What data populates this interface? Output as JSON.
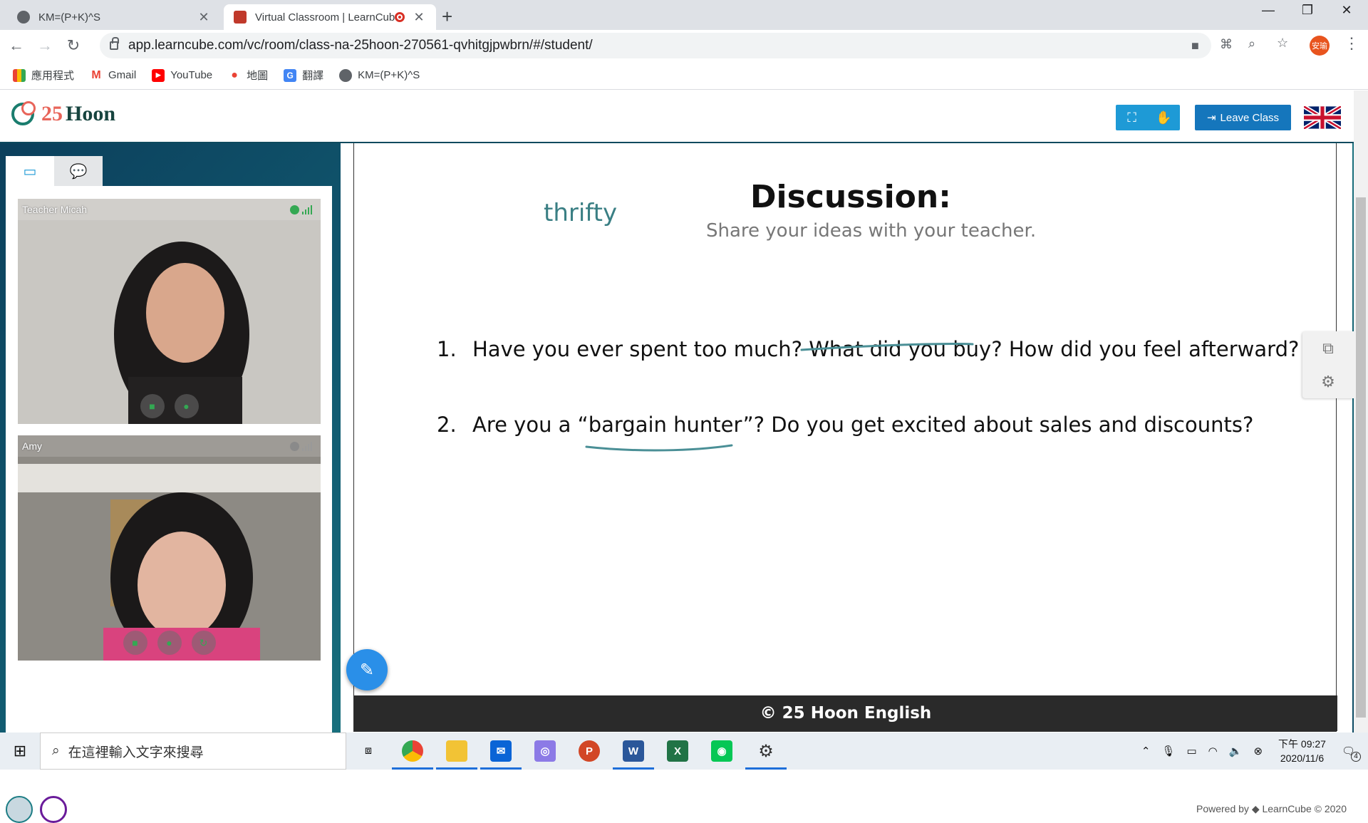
{
  "browser": {
    "tabs": [
      {
        "title": "KM=(P+K)^S",
        "active": false
      },
      {
        "title": "Virtual Classroom | LearnCube",
        "active": true
      }
    ],
    "url": "app.learncube.com/vc/room/class-na-25hoon-270561-qvhitgjpwbrn/#/student/",
    "profile_label": "安瑜",
    "bookmarks": [
      "應用程式",
      "Gmail",
      "YouTube",
      "地圖",
      "翻譯",
      "KM=(P+K)^S"
    ]
  },
  "app": {
    "logo": {
      "number": "25",
      "word": "Hoon"
    },
    "leave_label": "Leave Class",
    "participants": [
      {
        "name": "Teacher Micah",
        "status_color": "#34a853"
      },
      {
        "name": "Amy",
        "status_color": "#8a8a8a"
      }
    ],
    "powered_by": "Powered by ◆ LearnCube © 2020"
  },
  "slide": {
    "word": "thrifty",
    "title": "Discussion:",
    "subtitle": "Share your ideas with your teacher.",
    "questions": [
      {
        "num": "1.",
        "text": "Have you ever spent too much? What did you buy? How did you feel afterward?"
      },
      {
        "num": "2.",
        "text": "Are you a “bargain hunter”? Do you get excited about sales and discounts?"
      }
    ],
    "footer": "© 25 Hoon English"
  },
  "taskbar": {
    "search_placeholder": "在這裡輸入文字來搜尋",
    "time": "下午 09:27",
    "date": "2020/11/6",
    "notification_count": "4"
  },
  "colors": {
    "accent": "#1e9ad6",
    "leave": "#1576bc",
    "logo_red": "#e8655a",
    "logo_green": "#17443f",
    "slide_word": "#3a7f84",
    "ink": "#4a8f96"
  }
}
